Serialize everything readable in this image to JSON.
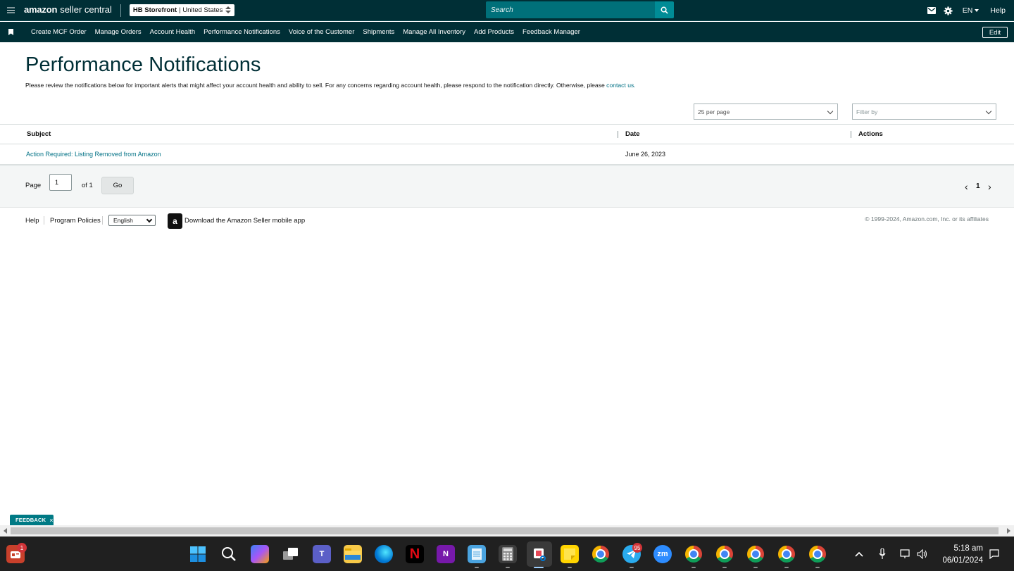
{
  "header": {
    "brand_amazon": "amazon",
    "brand_product": "seller central",
    "store_name": "HB Storefront",
    "store_region": "| United States",
    "search_placeholder": "Search",
    "language": "EN",
    "help": "Help"
  },
  "nav": {
    "items": [
      "Create MCF Order",
      "Manage Orders",
      "Account Health",
      "Performance Notifications",
      "Voice of the Customer",
      "Shipments",
      "Manage All Inventory",
      "Add Products",
      "Feedback Manager"
    ],
    "edit": "Edit"
  },
  "page": {
    "title": "Performance Notifications",
    "intro": "Please review the notifications below for important alerts that might affect your account health and ability to sell. For any concerns regarding account health, please respond to the notification directly. Otherwise, please ",
    "intro_link": "contact us.",
    "per_page": "25 per page",
    "filter_placeholder": "Filter by"
  },
  "table": {
    "columns": [
      "Subject",
      "Date",
      "Actions"
    ],
    "rows": [
      {
        "subject": "Action Required: Listing Removed from Amazon",
        "date": "June 26, 2023",
        "actions": ""
      }
    ]
  },
  "pager": {
    "page_label": "Page",
    "page_value": "1",
    "of_label": "of 1",
    "go": "Go",
    "prev": "‹",
    "current": "1",
    "next": "›"
  },
  "footer": {
    "help": "Help",
    "policies": "Program Policies",
    "language": "English",
    "app_icon_letter": "a",
    "app_text": "Download the Amazon Seller mobile app",
    "copyright": "© 1999-2024, Amazon.com, Inc. or its affiliates"
  },
  "feedback": {
    "label": "FEEDBACK",
    "close": "×"
  },
  "taskbar": {
    "widget_badge": "1",
    "telegram_badge": "95",
    "zoom_label": "zm",
    "netflix_label": "N",
    "onenote_label": "N",
    "teams_label": "T",
    "time": "5:18 am",
    "date": "06/01/2024"
  },
  "colors": {
    "header_bg": "#002f36",
    "link": "#007185",
    "search_bg": "#00707a",
    "feedback_bg": "#007a85"
  }
}
